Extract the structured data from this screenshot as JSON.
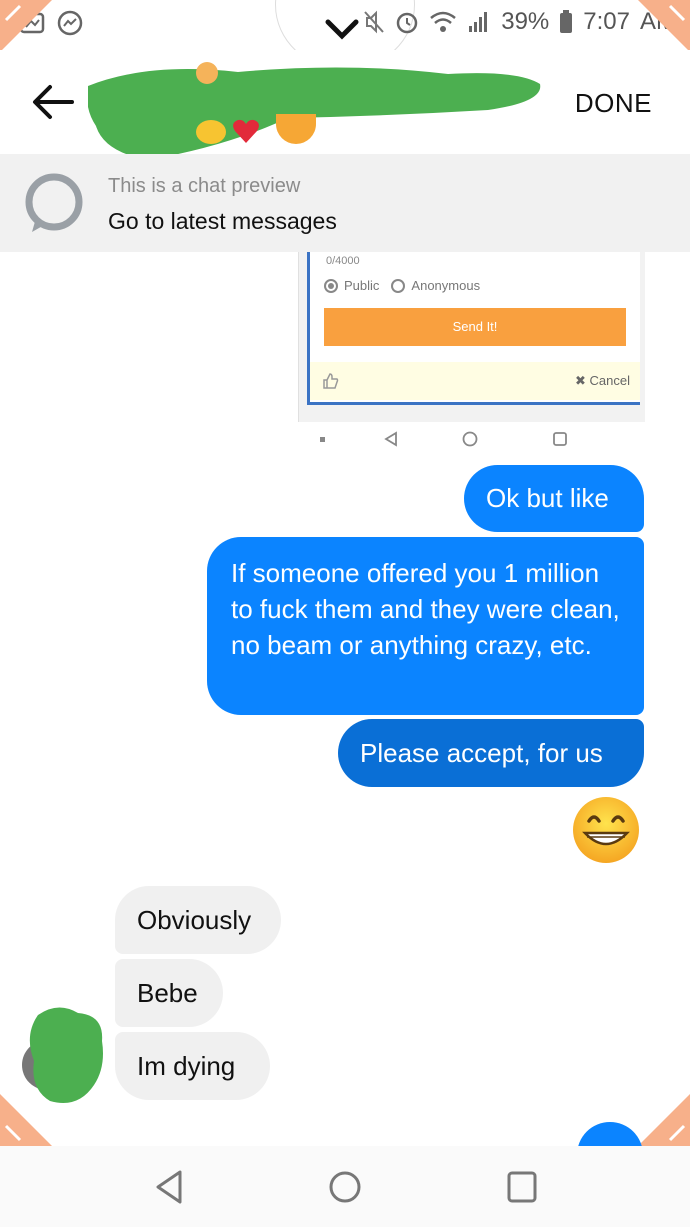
{
  "status_bar": {
    "battery": "39%",
    "time": "7:07",
    "ampm": "AM"
  },
  "header": {
    "done_label": "DONE"
  },
  "preview_bar": {
    "small_text": "This is a chat preview",
    "main_text": "Go to latest messages"
  },
  "shared_screenshot": {
    "char_count": "0/4000",
    "option_public": "Public",
    "option_anonymous": "Anonymous",
    "send_label": "Send It!",
    "cancel_label": "✖ Cancel"
  },
  "messages_out": [
    "Ok but like",
    "If someone offered you 1 million to fuck them and they were clean, no beam or anything crazy, etc.",
    "Please accept, for us"
  ],
  "emoji_reaction": "grinning-face",
  "messages_in": [
    "Obviously",
    "Bebe",
    "Im dying"
  ],
  "colors": {
    "outgoing": "#0b84ff",
    "outgoing_dark": "#0a6fd6",
    "incoming": "#f0f0f0",
    "redaction": "#4caf50",
    "corner": "#f7b08a"
  }
}
